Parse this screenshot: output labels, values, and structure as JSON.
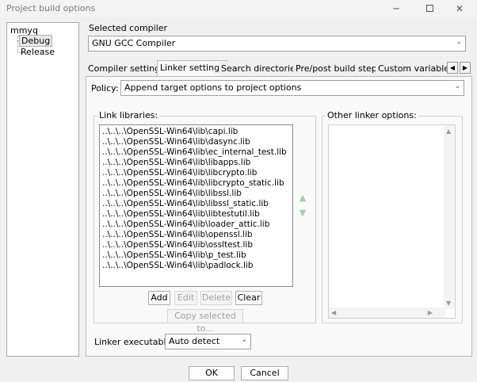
{
  "window": {
    "title": "Project build options",
    "minimize_glyph": "─",
    "close_glyph": "✕"
  },
  "tree": {
    "root": "mmyq",
    "children": [
      "Debug",
      "Release"
    ],
    "selected": "Debug"
  },
  "compiler": {
    "label": "Selected compiler",
    "value": "GNU GCC Compiler"
  },
  "tabs": [
    {
      "label": "Compiler settings"
    },
    {
      "label": "Linker settings"
    },
    {
      "label": "Search directories"
    },
    {
      "label": "Pre/post build steps"
    },
    {
      "label": "Custom variables"
    }
  ],
  "active_tab": "Linker settings",
  "policy": {
    "label": "Policy:",
    "value": "Append target options to project options"
  },
  "link_libraries": {
    "title": "Link libraries:",
    "items": [
      "..\\..\\..\\OpenSSL-Win64\\lib\\capi.lib",
      "..\\..\\..\\OpenSSL-Win64\\lib\\dasync.lib",
      "..\\..\\..\\OpenSSL-Win64\\lib\\ec_internal_test.lib",
      "..\\..\\..\\OpenSSL-Win64\\lib\\libapps.lib",
      "..\\..\\..\\OpenSSL-Win64\\lib\\libcrypto.lib",
      "..\\..\\..\\OpenSSL-Win64\\lib\\libcrypto_static.lib",
      "..\\..\\..\\OpenSSL-Win64\\lib\\libssl.lib",
      "..\\..\\..\\OpenSSL-Win64\\lib\\libssl_static.lib",
      "..\\..\\..\\OpenSSL-Win64\\lib\\libtestutil.lib",
      "..\\..\\..\\OpenSSL-Win64\\lib\\loader_attic.lib",
      "..\\..\\..\\OpenSSL-Win64\\lib\\openssl.lib",
      "..\\..\\..\\OpenSSL-Win64\\lib\\ossltest.lib",
      "..\\..\\..\\OpenSSL-Win64\\lib\\p_test.lib",
      "..\\..\\..\\OpenSSL-Win64\\lib\\padlock.lib"
    ],
    "buttons": {
      "add": "Add",
      "edit": "Edit",
      "delete": "Delete",
      "clear": "Clear",
      "copy": "Copy selected to..."
    }
  },
  "other_linker": {
    "title": "Other linker options:"
  },
  "linker_exec": {
    "label": "Linker executable:",
    "value": "Auto detect"
  },
  "footer": {
    "ok": "OK",
    "cancel": "Cancel"
  },
  "icons": {
    "move_up": "▲",
    "move_down": "▼",
    "dropdown": "⌄"
  }
}
